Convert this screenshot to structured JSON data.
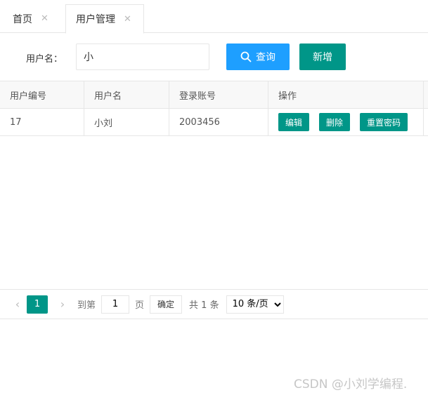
{
  "tabs": [
    {
      "label": "首页",
      "close": "✕",
      "active": false
    },
    {
      "label": "用户管理",
      "close": "✕",
      "active": true
    }
  ],
  "search": {
    "label": "用户名：",
    "value": "小",
    "query_label": "查询",
    "add_label": "新增"
  },
  "table": {
    "headers": [
      "用户编号",
      "用户名",
      "登录账号",
      "操作"
    ],
    "rows": [
      {
        "id": "17",
        "name": "小刘",
        "account": "2003456",
        "actions": [
          "编辑",
          "删除",
          "重置密码"
        ]
      }
    ]
  },
  "pager": {
    "prev": "‹",
    "current": "1",
    "next": "›",
    "goto_label": "到第",
    "goto_value": "1",
    "page_unit": "页",
    "confirm_label": "确定",
    "total_text": "共 1 条",
    "page_size": "10 条/页"
  },
  "watermark": "CSDN @小刘学编程.",
  "colors": {
    "primary": "#009688",
    "query": "#1e9fff",
    "border": "#e6e6e6"
  }
}
